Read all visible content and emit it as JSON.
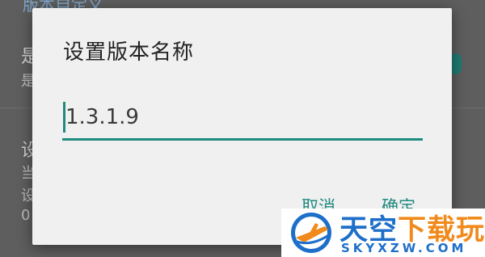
{
  "background": {
    "header": "版本自定义",
    "row1_title": "是",
    "row1_sub": "是",
    "row2_title": "设",
    "row2_sub_1": "当",
    "row2_sub_2": "设",
    "row2_sub_3": "0"
  },
  "dialog": {
    "title": "设置版本名称",
    "input_value": "1.3.1.9",
    "cancel_label": "取消",
    "ok_label": "确定"
  },
  "watermark": {
    "title_main": "天空",
    "title_accent": "下载玩",
    "url": "SKYXZW.COM"
  },
  "colors": {
    "accent": "#1f8a80",
    "brand_blue": "#1d6fc9",
    "brand_orange": "#f08a1c"
  }
}
